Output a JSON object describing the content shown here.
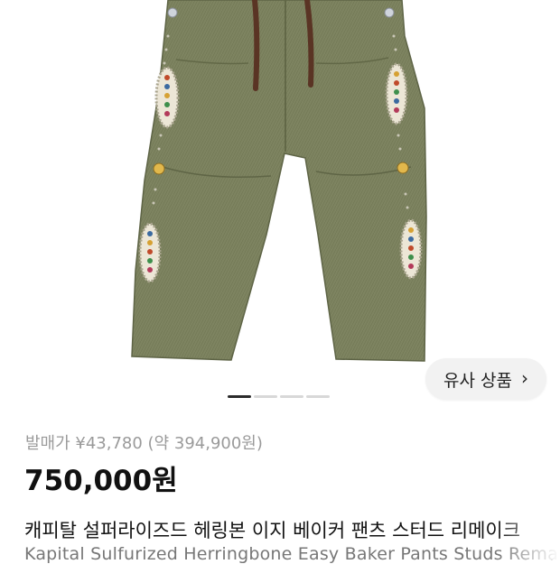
{
  "product": {
    "image_alt": "Olive herringbone baker pants with studded embellishments",
    "similar_button_label": "유사 상품",
    "similar_button_icon": "chevron-right-icon",
    "carousel": {
      "count": 4,
      "active_index": 0
    },
    "original_price": "발매가 ¥43,780 (약 394,900원)",
    "price": "750,000원",
    "title_ko": "캐피탈 설퍼라이즈드 헤링본 이지 베이커 팬츠 스터드 리메이크",
    "title_en": "Kapital Sulfurized Herringbone Easy Baker Pants Studs Remake"
  },
  "colors": {
    "pants": "#7d8360",
    "pants_shadow": "#6b7050",
    "drawstring": "#5a3424",
    "accent": "#111111"
  }
}
